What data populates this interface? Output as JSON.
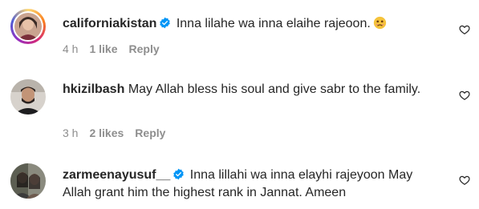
{
  "comments": [
    {
      "username": "californiakistan",
      "verified": true,
      "text": "Inna lilahe wa inna elaihe rajeoon.",
      "time": "4 h",
      "likes": "1 like",
      "reply": "Reply",
      "emoji": "sad-face-emoji"
    },
    {
      "username": "hkizilbash",
      "verified": false,
      "text": "May Allah bless his soul and give sabr to the family.",
      "time": "3 h",
      "likes": "2 likes",
      "reply": "Reply"
    },
    {
      "username": "zarmeenayusuf__",
      "verified": true,
      "text": "Inna lillahi wa inna elayhi rajeyoon May Allah grant him the highest rank in Jannat. Ameen"
    }
  ],
  "colors": {
    "text": "#262626",
    "meta": "#8e8e8e",
    "verified": "#0095f6"
  },
  "icons": [
    "verified-badge-icon",
    "heart-icon",
    "sad-face-emoji"
  ]
}
